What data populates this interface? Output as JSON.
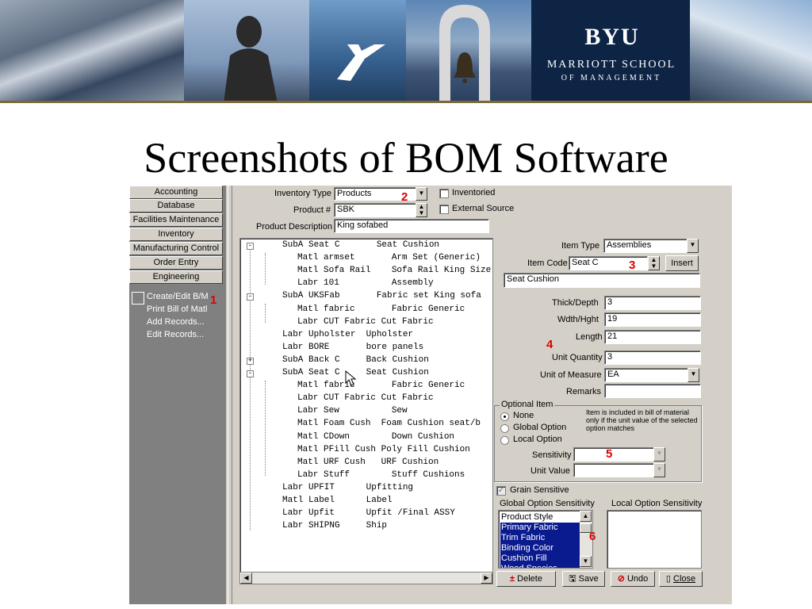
{
  "slide_title": "Screenshots of BOM Software",
  "banner": {
    "logo": "BYU",
    "school_line1": "MARRIOTT SCHOOL",
    "school_line2": "OF MANAGEMENT"
  },
  "nav": {
    "items": [
      "Accounting",
      "Database",
      "Facilities Maintenance",
      "Inventory",
      "Manufacturing Control",
      "Order Entry",
      "Engineering"
    ],
    "sub_items": [
      "Create/Edit B/M",
      "Print Bill of Matl",
      "Add Records...",
      "Edit Records..."
    ]
  },
  "markers": [
    "1",
    "2",
    "3",
    "4",
    "5",
    "6"
  ],
  "top_form": {
    "inventory_type_label": "Inventory Type",
    "inventory_type_value": "Products",
    "inventoried_label": "Inventoried",
    "product_num_label": "Product #",
    "product_num_value": "SBK",
    "external_source_label": "External Source",
    "product_desc_label": "Product Description",
    "product_desc_value": "King sofabed"
  },
  "tree_rows": [
    {
      "text": "SubA Seat C       Seat Cushion",
      "level": 0,
      "toggle": "-"
    },
    {
      "text": "Matl armset       Arm Set (Generic)",
      "level": 1,
      "toggle": ""
    },
    {
      "text": "Matl Sofa Rail    Sofa Rail King Size",
      "level": 1,
      "toggle": ""
    },
    {
      "text": "Labr 101          Assembly",
      "level": 1,
      "toggle": ""
    },
    {
      "text": "SubA UKSFab       Fabric set King sofa",
      "level": 0,
      "toggle": "-"
    },
    {
      "text": "Matl fabric       Fabric Generic",
      "level": 1,
      "toggle": ""
    },
    {
      "text": "Labr CUT Fabric Cut Fabric",
      "level": 1,
      "toggle": ""
    },
    {
      "text": "Labr Upholster  Upholster",
      "level": 0,
      "toggle": ""
    },
    {
      "text": "Labr BORE       bore panels",
      "level": 0,
      "toggle": ""
    },
    {
      "text": "SubA Back C     Back Cushion",
      "level": 0,
      "toggle": "+"
    },
    {
      "text": "SubA Seat C     Seat Cushion",
      "level": 0,
      "toggle": "-"
    },
    {
      "text": "Matl fabric       Fabric Generic",
      "level": 1,
      "toggle": ""
    },
    {
      "text": "Labr CUT Fabric Cut Fabric",
      "level": 1,
      "toggle": ""
    },
    {
      "text": "Labr Sew          Sew",
      "level": 1,
      "toggle": ""
    },
    {
      "text": "Matl Foam Cush  Foam Cushion seat/b",
      "level": 1,
      "toggle": ""
    },
    {
      "text": "Matl CDown        Down Cushion",
      "level": 1,
      "toggle": ""
    },
    {
      "text": "Matl PFill Cush Poly Fill Cushion",
      "level": 1,
      "toggle": ""
    },
    {
      "text": "Matl URF Cush   URF Cushion",
      "level": 1,
      "toggle": ""
    },
    {
      "text": "Labr Stuff        Stuff Cushions",
      "level": 1,
      "toggle": ""
    },
    {
      "text": "Labr UPFIT      Upfitting",
      "level": 0,
      "toggle": ""
    },
    {
      "text": "Matl Label      Label",
      "level": 0,
      "toggle": ""
    },
    {
      "text": "Labr Upfit      Upfit /Final ASSY",
      "level": 0,
      "toggle": ""
    },
    {
      "text": "Labr SHIPNG     Ship",
      "level": 0,
      "toggle": ""
    }
  ],
  "item_form": {
    "item_type_label": "Item Type",
    "item_type_value": "Assemblies",
    "item_code_label": "Item Code",
    "item_code_value": "Seat C",
    "insert_label": "Insert",
    "description_value": "Seat Cushion",
    "thick_label": "Thick/Depth",
    "thick_value": "3",
    "wdth_label": "Wdth/Hght",
    "wdth_value": "19",
    "length_label": "Length",
    "length_value": "21",
    "unit_qty_label": "Unit Quantity",
    "unit_qty_value": "3",
    "uom_label": "Unit of Measure",
    "uom_value": "EA",
    "remarks_label": "Remarks",
    "remarks_value": ""
  },
  "optional_item": {
    "group_label": "Optional Item",
    "options": [
      "None",
      "Global Option",
      "Local Option"
    ],
    "selected": "None",
    "note": "Item is included in bill of material only if the unit value of the selected option matches",
    "sensitivity_label": "Sensitivity",
    "unit_value_label": "Unit Value"
  },
  "grain_sensitive_label": "Grain Sensitive",
  "global_sens_label": "Global Option Sensitivity",
  "local_sens_label": "Local Option Sensitivity",
  "global_list": [
    {
      "label": "Product Style",
      "selected": false
    },
    {
      "label": "Primary Fabric",
      "selected": true
    },
    {
      "label": "Trim Fabric",
      "selected": true
    },
    {
      "label": "Binding Color",
      "selected": true
    },
    {
      "label": "Cushion Fill",
      "selected": true
    },
    {
      "label": "Wood Species",
      "selected": true
    }
  ],
  "buttons": {
    "delete": "Delete",
    "save": "Save",
    "undo": "Undo",
    "close": "Close"
  },
  "colors": {
    "window": "#d4d0c8",
    "selection": "#0a1a8f",
    "marker": "#e00000",
    "banner": "#0d2445"
  }
}
